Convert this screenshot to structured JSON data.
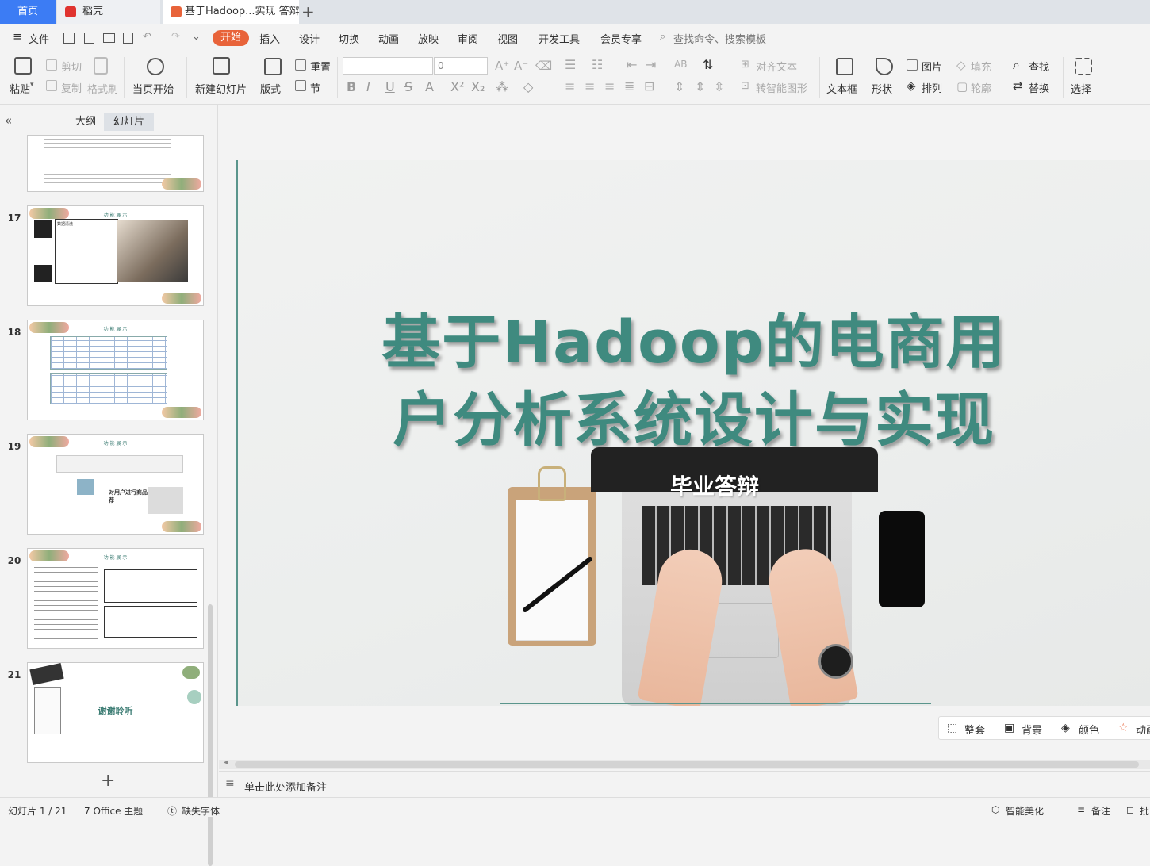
{
  "tabs": {
    "home": "首页",
    "daoke": "稻壳",
    "document": "基于Hadoop...实现 答辩PPT",
    "add": "+"
  },
  "menu": {
    "file": "文件",
    "items": [
      "开始",
      "插入",
      "设计",
      "切换",
      "动画",
      "放映",
      "审阅",
      "视图",
      "开发工具",
      "会员专享"
    ],
    "search_placeholder": "查找命令、搜索模板"
  },
  "toolbar": {
    "paste": "粘贴",
    "cut": "剪切",
    "copy": "复制",
    "format_painter": "格式刷",
    "from_start": "当页开始",
    "new_slide": "新建幻灯片",
    "layout": "版式",
    "reset": "重置",
    "section": "节",
    "font_size": "0",
    "align_text": "对齐文本",
    "smart_art": "转智能图形",
    "textbox": "文本框",
    "shape": "形状",
    "picture": "图片",
    "arrange": "排列",
    "fill": "填充",
    "outline": "轮廓",
    "find": "查找",
    "replace": "替换",
    "select": "选择"
  },
  "left_pane": {
    "tab_outline": "大纲",
    "tab_slides": "幻灯片",
    "collapse_icon": "double-chevron-left-icon",
    "slide_numbers": [
      "17",
      "18",
      "19",
      "20",
      "21"
    ],
    "thumb_header": "功 能 展 示",
    "thumb17_caption": "数据清洗",
    "thumb19_caption": "对用户进行商品推荐",
    "thumb21_caption": "谢谢聆听",
    "add_slide": "+"
  },
  "slide": {
    "title_line1": "基于Hadoop的电商用",
    "title_line2": "户分析系统设计与实现",
    "subtitle": "毕业答辩",
    "title_color": "#3f8a7f"
  },
  "float_bar": {
    "whole_set": "整套",
    "background": "背景",
    "color": "颜色",
    "animation": "动画"
  },
  "notes": {
    "placeholder": "单击此处添加备注"
  },
  "status": {
    "slide_index": "幻灯片 1 / 21",
    "theme": "7 Office 主题",
    "missing_font": "缺失字体",
    "beautify": "智能美化",
    "notes": "备注",
    "comment": "批"
  },
  "colors": {
    "accent": "#e8633a",
    "home_tab": "#3c7cf4"
  }
}
